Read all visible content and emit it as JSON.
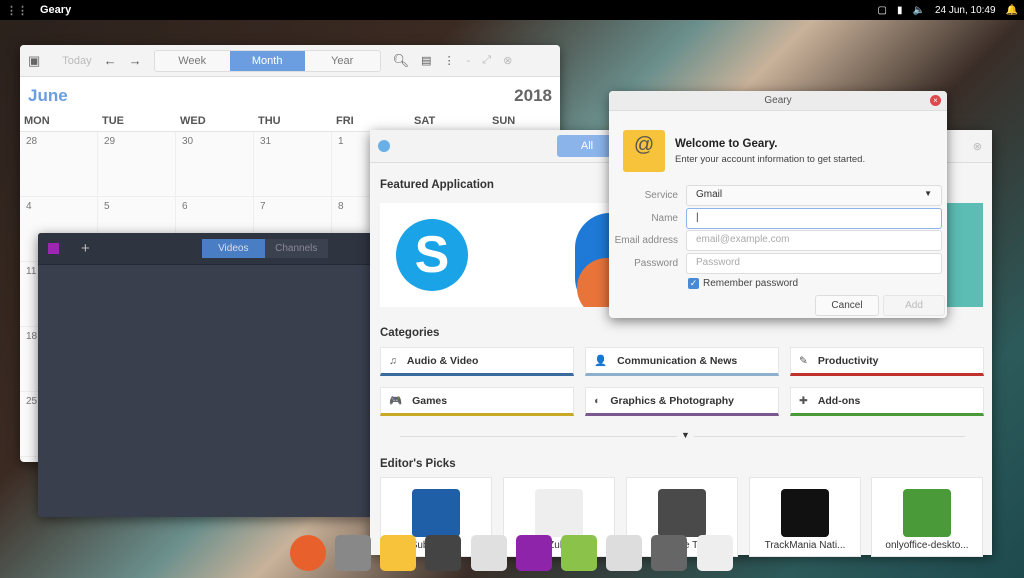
{
  "topbar": {
    "app": "Geary",
    "datetime": "24 Jun, 10:49"
  },
  "calendar": {
    "today": "Today",
    "views": [
      "Week",
      "Month",
      "Year"
    ],
    "month": "June",
    "year": "2018",
    "days": [
      "MON",
      "TUE",
      "WED",
      "THU",
      "FRI",
      "SAT",
      "SUN"
    ],
    "rows": [
      [
        "28",
        "29",
        "30",
        "31",
        "1",
        "",
        ""
      ],
      [
        "4",
        "5",
        "6",
        "7",
        "8",
        "",
        ""
      ],
      [
        "11",
        "",
        "",
        "",
        "",
        "",
        ""
      ],
      [
        "18",
        "",
        "",
        "",
        "",
        "",
        ""
      ],
      [
        "25",
        "",
        "",
        "",
        "",
        "",
        ""
      ]
    ]
  },
  "videos": {
    "tabs": [
      "Videos",
      "Channels"
    ],
    "add": "+"
  },
  "appcenter": {
    "tab_all": "All",
    "featured_title": "Featured Application",
    "categories_title": "Categories",
    "categories": [
      {
        "label": "Audio & Video",
        "icon": "♫",
        "color": "#3a6a9e"
      },
      {
        "label": "Communication & News",
        "icon": "👤",
        "color": "#8fb0cc"
      },
      {
        "label": "Productivity",
        "icon": "✎",
        "color": "#c0312b"
      },
      {
        "label": "Games",
        "icon": "🎮",
        "color": "#c9a826"
      },
      {
        "label": "Graphics & Photography",
        "icon": "◐",
        "color": "#7a5a8e"
      },
      {
        "label": "Add-ons",
        "icon": "✚",
        "color": "#4a9a3a"
      }
    ],
    "picks_title": "Editor's Picks",
    "picks": [
      {
        "label": "Subsurface",
        "color": "#1f5fa8"
      },
      {
        "label": "Zulip",
        "color": "#eeeeee"
      },
      {
        "label": "Sublime Text",
        "color": "#4a4a4a"
      },
      {
        "label": "TrackMania Nati...",
        "color": "#111111"
      },
      {
        "label": "onlyoffice-deskto...",
        "color": "#4a9a3a"
      }
    ]
  },
  "dialog": {
    "title": "Geary",
    "heading": "Welcome to Geary.",
    "subheading": "Enter your account information to get started.",
    "service_label": "Service",
    "service_value": "Gmail",
    "name_label": "Name",
    "name_value": "",
    "email_label": "Email address",
    "email_placeholder": "email@example.com",
    "password_label": "Password",
    "password_placeholder": "Password",
    "remember_label": "Remember password",
    "remember_checked": true,
    "cancel": "Cancel",
    "add": "Add"
  }
}
